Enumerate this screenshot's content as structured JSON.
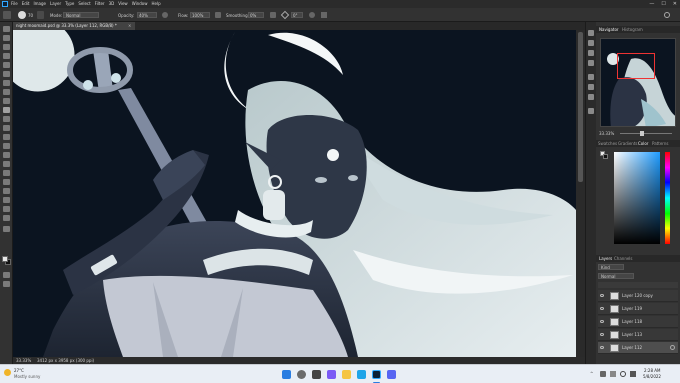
{
  "menubar": {
    "app_icon": "ps-logo",
    "menus": [
      "File",
      "Edit",
      "Image",
      "Layer",
      "Type",
      "Select",
      "Filter",
      "3D",
      "View",
      "Window",
      "Help"
    ],
    "window_controls": [
      "—",
      "☐",
      "✕"
    ]
  },
  "options": {
    "brush_size": "70",
    "mode_label": "Mode:",
    "mode_value": "Normal",
    "opacity_label": "Opacity:",
    "opacity_value": "40%",
    "flow_label": "Flow:",
    "flow_value": "100%",
    "smoothing_label": "Smoothing:",
    "smoothing_value": "0%",
    "angle_value": "0°"
  },
  "document": {
    "tab_title": "night moomaid.psd @ 33.3% (Layer 112, RGB/8) *",
    "zoom": "33.33%",
    "doc_info": "3412 px x 3958 px (300 ppi)"
  },
  "panels": {
    "top_tabs": [
      "Navigator",
      "Histogram"
    ],
    "nav_zoom": "33.33%",
    "color_tabs": [
      "Swatches",
      "Gradients",
      "Color",
      "Patterns"
    ],
    "layers_tabs": [
      "Layers",
      "Channels"
    ],
    "kind_label": "Kind",
    "blend_mode": "Normal",
    "layers": [
      {
        "name": "Layer 120 copy",
        "selected": false
      },
      {
        "name": "Layer 119",
        "selected": false
      },
      {
        "name": "Layer 118",
        "selected": false
      },
      {
        "name": "Layer 113",
        "selected": false
      },
      {
        "name": "Layer 112",
        "selected": true
      }
    ]
  },
  "colors": {
    "canvas_bg": "#0b1420",
    "accent_red": "#e33333",
    "ps_blue": "#31a8ff"
  },
  "taskbar": {
    "weather_temp": "27°C",
    "weather_desc": "Mostly sunny",
    "time": "2:28 AM",
    "date": "5/8/2022"
  }
}
